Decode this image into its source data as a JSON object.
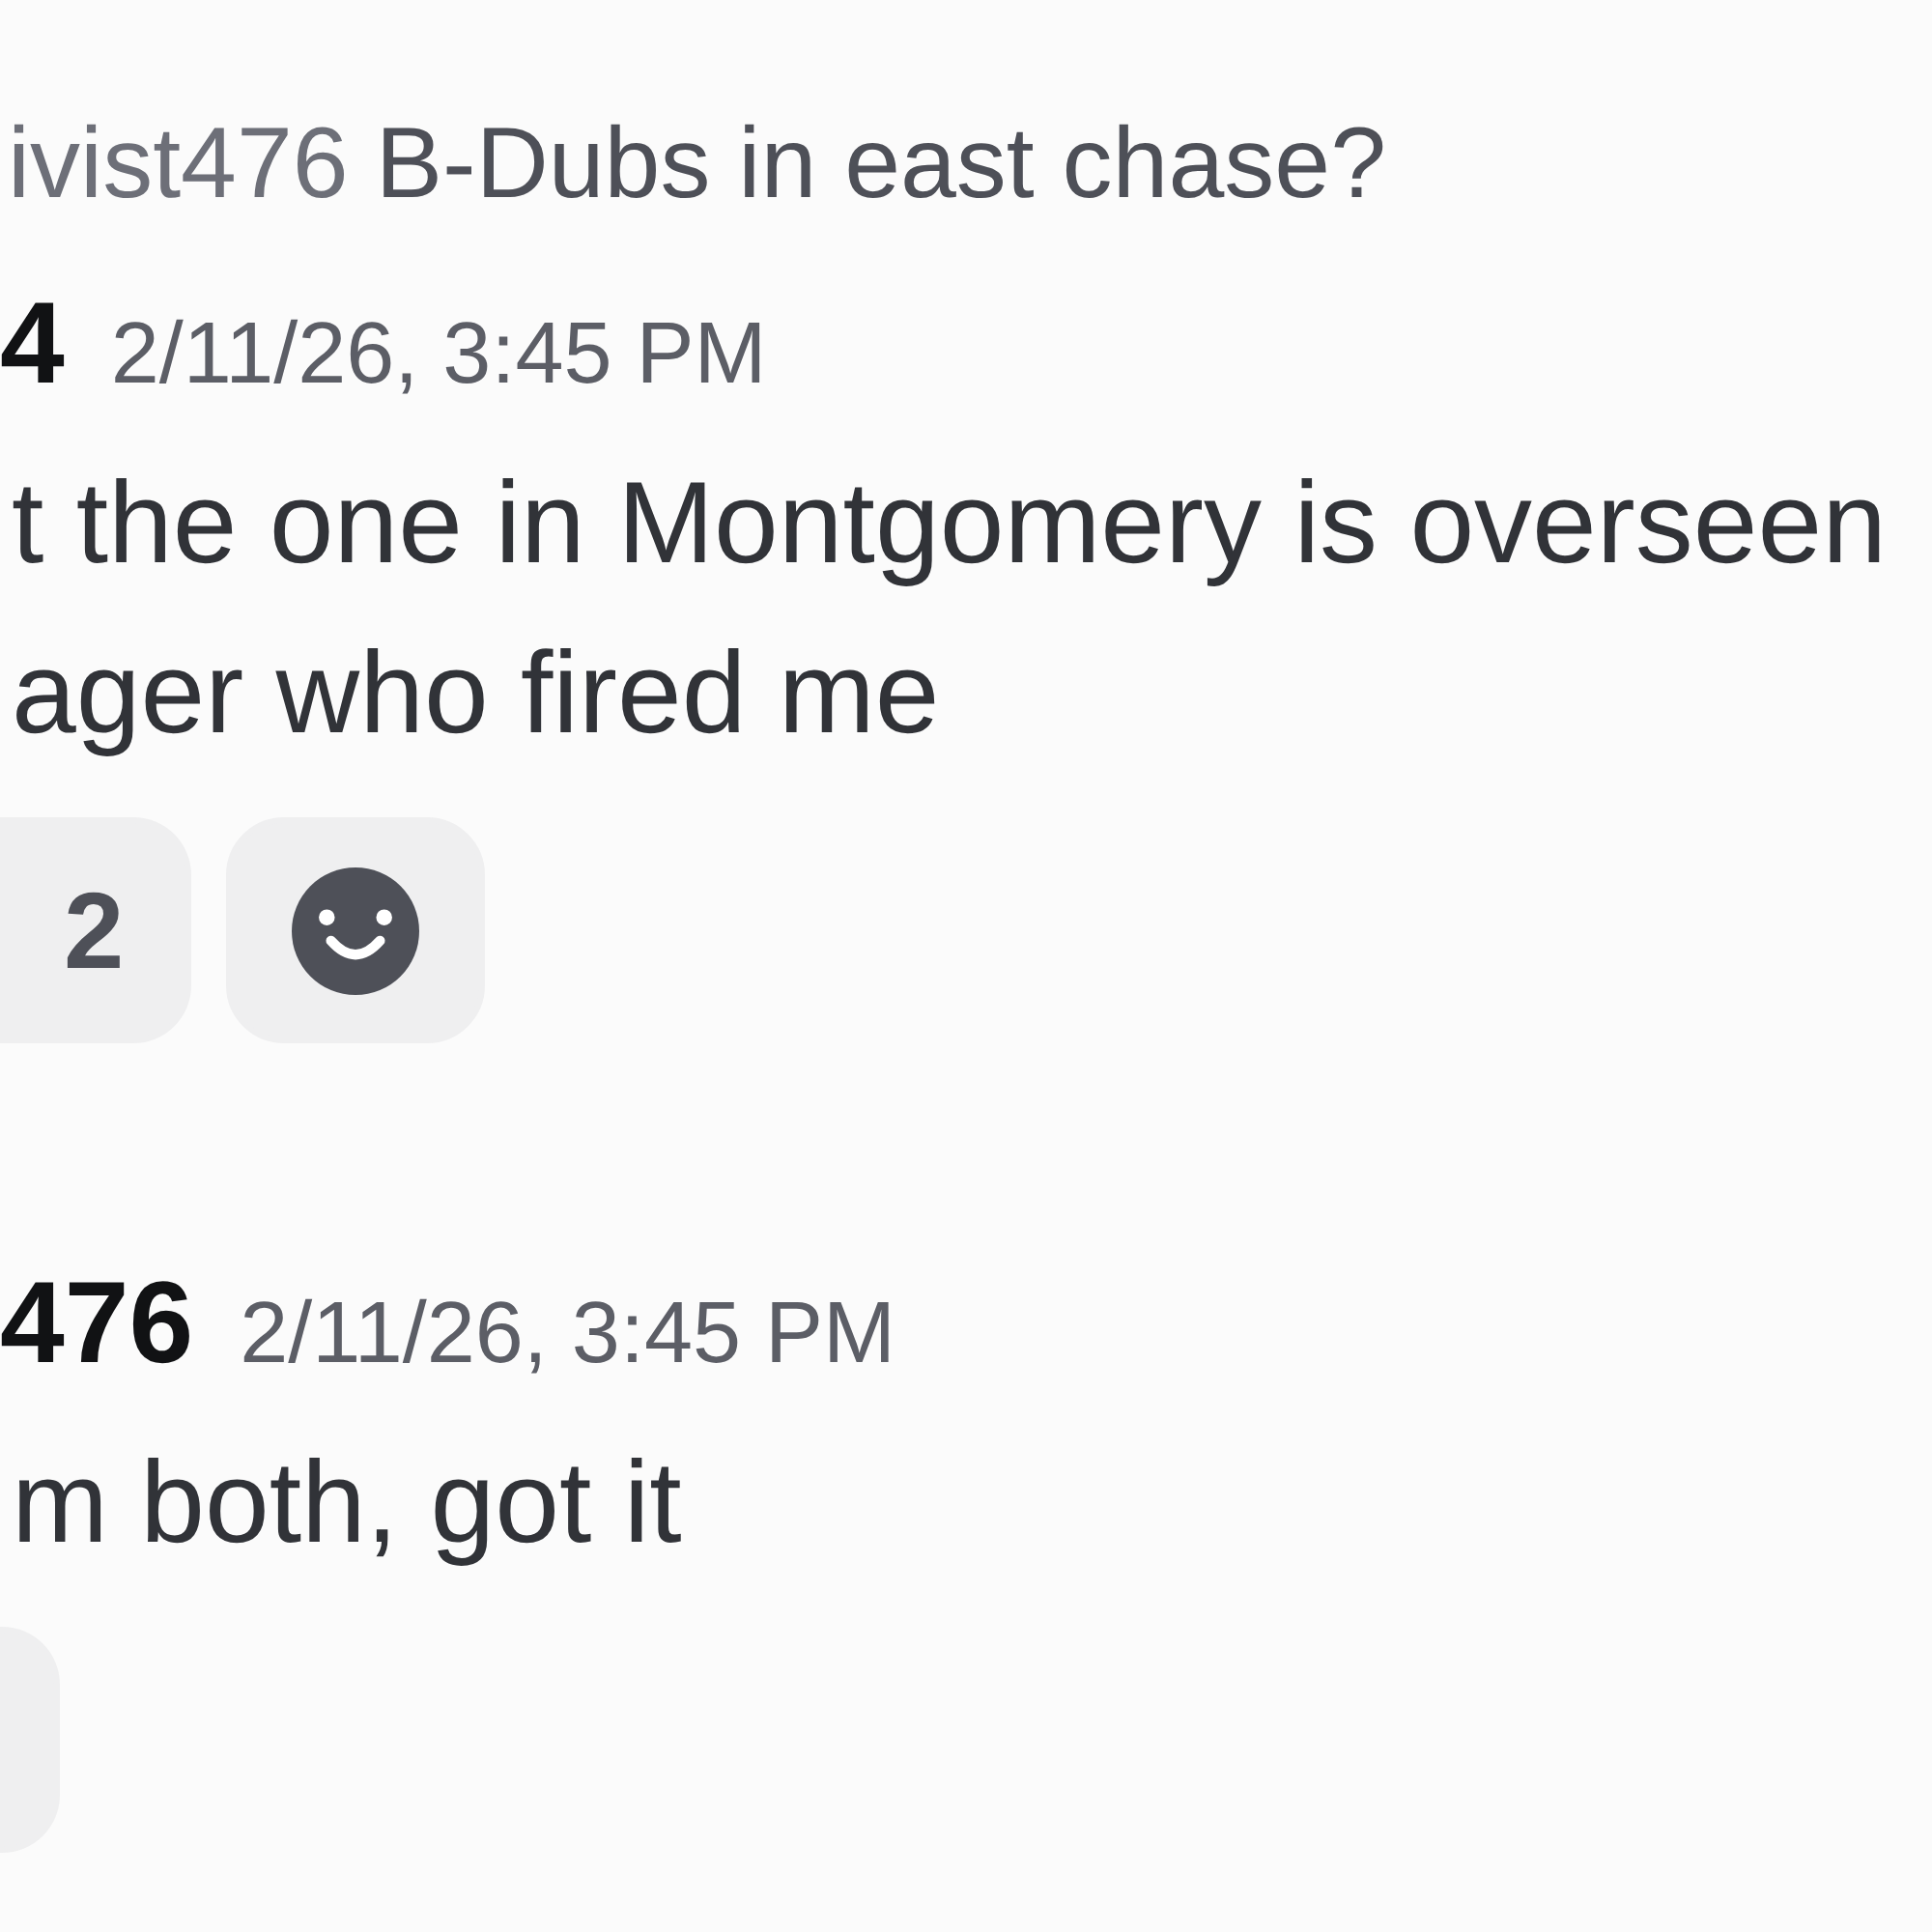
{
  "messages": [
    {
      "reply": {
        "author": "ivist476",
        "text": "B-Dubs in east chase?"
      },
      "author": "4",
      "timestamp": "2/11/26, 3:45 PM",
      "lines": [
        "t the one in Montgomery is overseen",
        "ager who fired me"
      ],
      "reactions": [
        {
          "kind": "emoji",
          "count": "2",
          "selected": false
        },
        {
          "kind": "add"
        }
      ]
    },
    {
      "author": "476",
      "timestamp": "2/11/26, 3:45 PM",
      "lines": [
        "m both, got it"
      ],
      "reactions": [
        {
          "kind": "emoji",
          "selected": false
        }
      ]
    }
  ]
}
